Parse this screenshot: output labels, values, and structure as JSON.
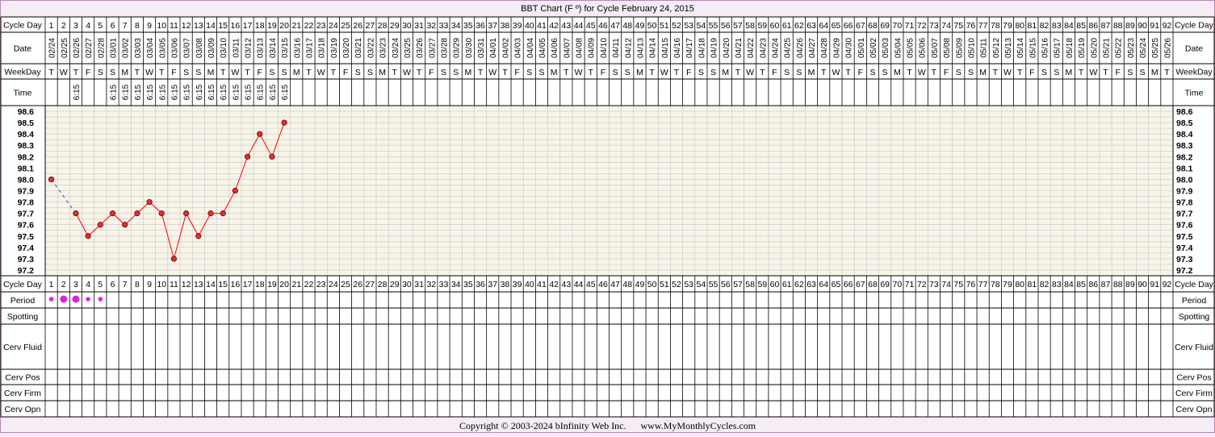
{
  "chart_data": {
    "type": "line",
    "title": "BBT Chart (F º) for Cycle February 24, 2015",
    "cycle_day_label": "Cycle Day",
    "date_label": "Date",
    "weekday_label": "WeekDay",
    "time_label": "Time",
    "row_labels": [
      "Period",
      "Spotting",
      "Cerv Fluid",
      "Cerv Pos",
      "Cerv Firm",
      "Cerv Opn"
    ],
    "num_days": 92,
    "start_date": "2015-02-24",
    "temp_ticks": [
      "98.6",
      "98.5",
      "98.4",
      "98.3",
      "98.2",
      "98.1",
      "98.0",
      "97.9",
      "97.8",
      "97.7",
      "97.6",
      "97.5",
      "97.4",
      "97.3",
      "97.2"
    ],
    "ylim": [
      97.2,
      98.6
    ],
    "times": [
      "",
      "",
      "6:15",
      "",
      "",
      "6:15",
      "6:15",
      "6:15",
      "6:15",
      "6:15",
      "6:15",
      "6:15",
      "6:15",
      "6:15",
      "6:15",
      "6:15",
      "6:15",
      "6:15",
      "6:15",
      "6:15"
    ],
    "temps": [
      {
        "day": 1,
        "temp": 98.0
      },
      {
        "day": 3,
        "temp": 97.7
      },
      {
        "day": 4,
        "temp": 97.5
      },
      {
        "day": 5,
        "temp": 97.6
      },
      {
        "day": 6,
        "temp": 97.7
      },
      {
        "day": 7,
        "temp": 97.6
      },
      {
        "day": 8,
        "temp": 97.7
      },
      {
        "day": 9,
        "temp": 97.8
      },
      {
        "day": 10,
        "temp": 97.7
      },
      {
        "day": 11,
        "temp": 97.3
      },
      {
        "day": 12,
        "temp": 97.7
      },
      {
        "day": 13,
        "temp": 97.5
      },
      {
        "day": 14,
        "temp": 97.7
      },
      {
        "day": 15,
        "temp": 97.7
      },
      {
        "day": 16,
        "temp": 97.9
      },
      {
        "day": 17,
        "temp": 98.2
      },
      {
        "day": 18,
        "temp": 98.4
      },
      {
        "day": 19,
        "temp": 98.2
      },
      {
        "day": 20,
        "temp": 98.5
      }
    ],
    "period": [
      {
        "day": 1,
        "flow": "light"
      },
      {
        "day": 2,
        "flow": "heavy"
      },
      {
        "day": 3,
        "flow": "heavy"
      },
      {
        "day": 4,
        "flow": "light"
      },
      {
        "day": 5,
        "flow": "light"
      }
    ]
  },
  "colors": {
    "background": "#f6ecf6",
    "plot_fill": "#f8f4e8",
    "grid_minor": "#c8c8c8",
    "line": "#ff0000",
    "dot_fill": "#e03030",
    "dash": "#4a4ad8",
    "period": "#e020e0"
  },
  "copyright": "Copyright © 2003-2024 bInfinity Web Inc.      www.MyMonthlyCycles.com"
}
